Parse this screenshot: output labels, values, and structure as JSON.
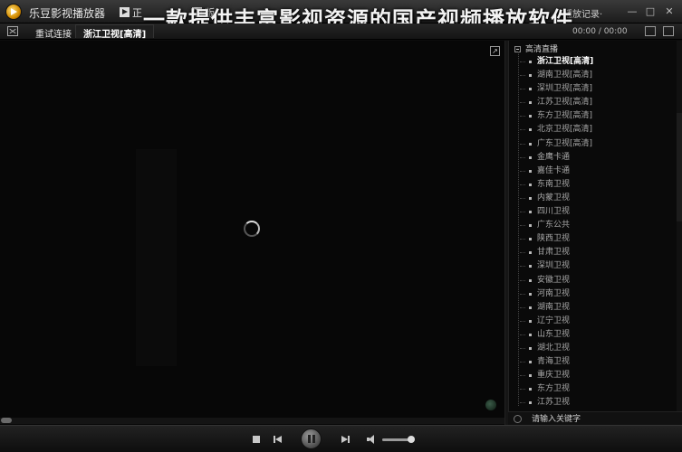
{
  "titlebar": {
    "app_title": "乐豆影视播放器",
    "tab_partial": "正",
    "tab2_partial": "版",
    "history_label": "播放记录·",
    "minimize": "—",
    "maximize": "□",
    "close": "✕"
  },
  "overlay": {
    "caption": "一款提供丰富影视资源的国产视频播放软件"
  },
  "toolbar": {
    "reconnect_label": "重试连接",
    "current_channel": "浙江卫视[高清]",
    "time": "00:00 / 00:00"
  },
  "sidebar": {
    "group_label": "高清直播",
    "channels": [
      {
        "label": "浙江卫视[高清]",
        "active": true
      },
      {
        "label": "湖南卫视[高清]"
      },
      {
        "label": "深圳卫视[高清]"
      },
      {
        "label": "江苏卫视[高清]"
      },
      {
        "label": "东方卫视[高清]"
      },
      {
        "label": "北京卫视[高清]"
      },
      {
        "label": "广东卫视[高清]"
      },
      {
        "label": "金鹰卡通"
      },
      {
        "label": "嘉佳卡通"
      },
      {
        "label": "东南卫视"
      },
      {
        "label": "内蒙卫视"
      },
      {
        "label": "四川卫视"
      },
      {
        "label": "广东公共"
      },
      {
        "label": "陕西卫视"
      },
      {
        "label": "甘肃卫视"
      },
      {
        "label": "深圳卫视"
      },
      {
        "label": "安徽卫视"
      },
      {
        "label": "河南卫视"
      },
      {
        "label": "湖南卫视"
      },
      {
        "label": "辽宁卫视"
      },
      {
        "label": "山东卫视"
      },
      {
        "label": "湖北卫视"
      },
      {
        "label": "青海卫视"
      },
      {
        "label": "重庆卫视"
      },
      {
        "label": "东方卫视"
      },
      {
        "label": "江苏卫视"
      }
    ],
    "search_placeholder": "请输入关键字"
  },
  "playback": {
    "progress_percent": 0,
    "volume_percent": 90
  },
  "colors": {
    "background": "#0d0d0d",
    "active_text": "#ffffff",
    "inactive_text": "#a8a8a8"
  }
}
